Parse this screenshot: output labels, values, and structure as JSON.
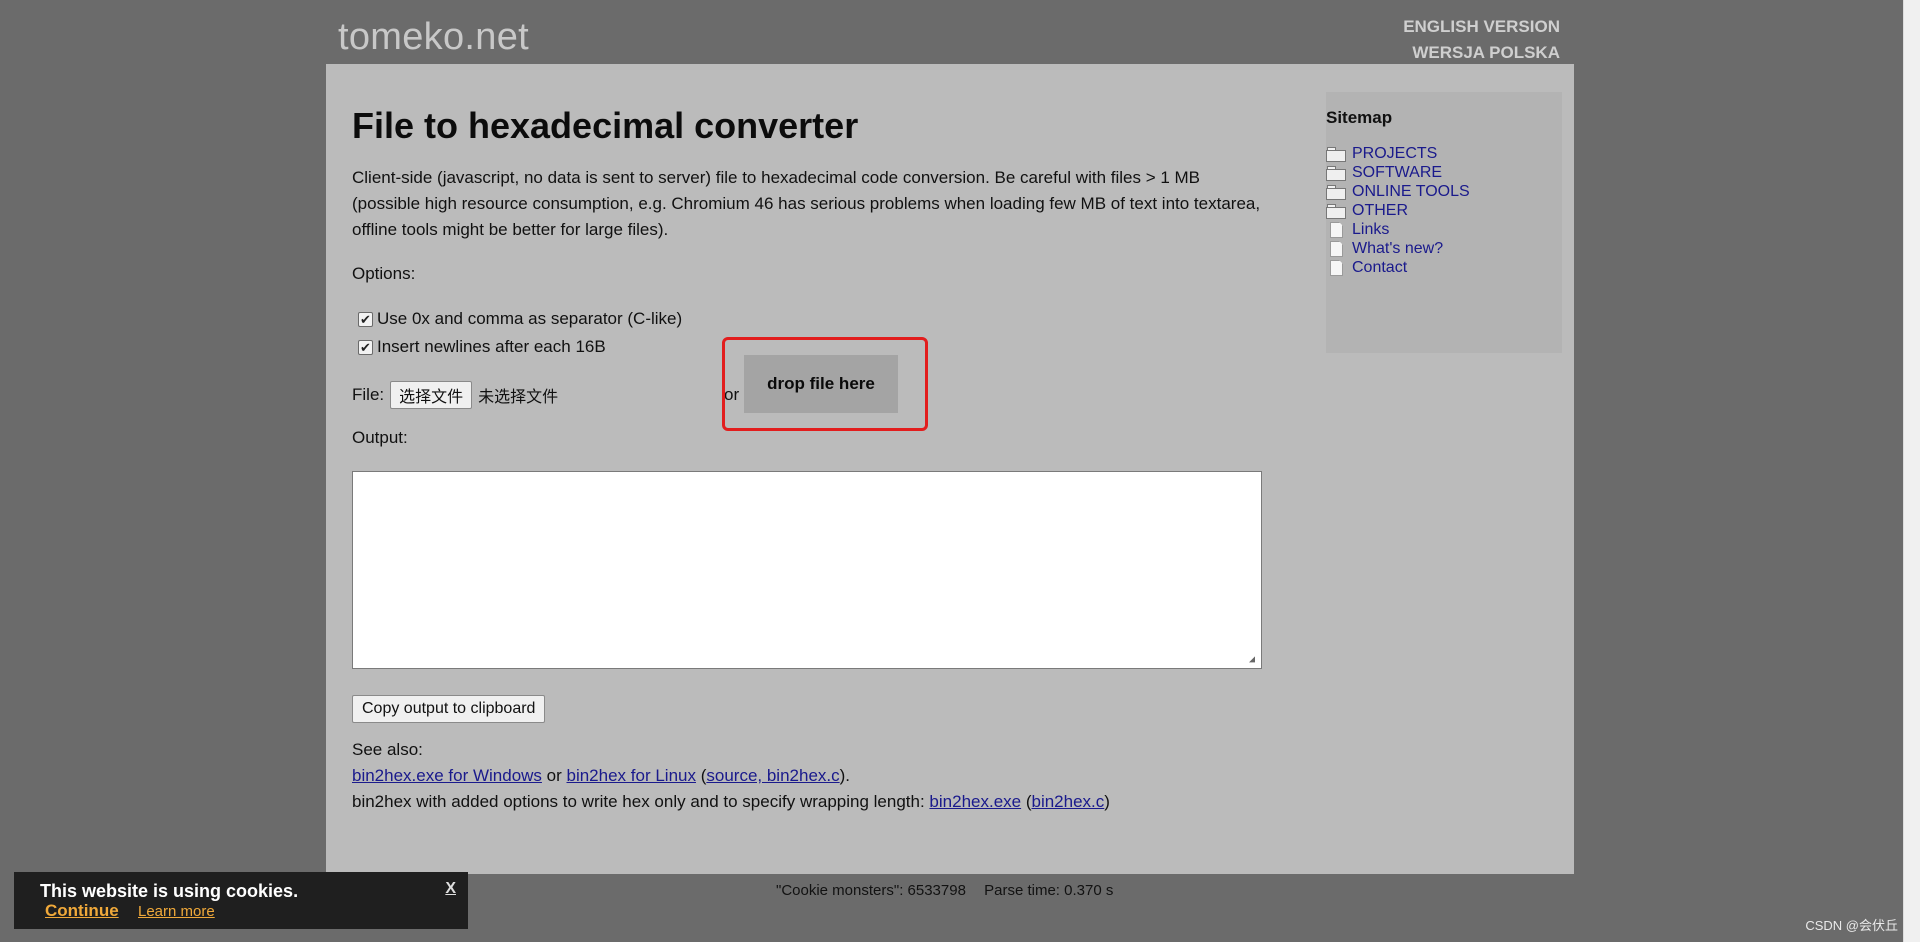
{
  "header": {
    "site_title": "tomeko.net",
    "lang_english": "ENGLISH VERSION",
    "lang_polish": "WERSJA POLSKA"
  },
  "main": {
    "title": "File to hexadecimal converter",
    "intro": "Client-side (javascript, no data is sent to server) file to hexadecimal code conversion. Be careful with files > 1 MB (possible high resource consumption, e.g. Chromium 46 has serious problems when loading few MB of text into textarea, offline tools might be better for large files).",
    "options_label": "Options:",
    "options": [
      {
        "label": "Use 0x and comma as separator (C-like)",
        "checked": true
      },
      {
        "label": "Insert newlines after each 16B",
        "checked": true
      }
    ],
    "file_label": "File:",
    "choose_button": "选择文件",
    "no_file_text": "未选择文件",
    "or_text": "or",
    "drop_zone_text": "drop file here",
    "output_label": "Output:",
    "output_value": "",
    "copy_button": "Copy output to clipboard",
    "see_also": {
      "heading": "See also:",
      "line1": {
        "link1": "bin2hex.exe for Windows",
        "sep1": " or ",
        "link2": "bin2hex for Linux",
        "paren_open": " (",
        "link3": "source, bin2hex.c",
        "paren_close": ")."
      },
      "line2": {
        "text": "bin2hex with added options to write hex only and to specify wrapping length: ",
        "link1": "bin2hex.exe",
        "paren_open": " (",
        "link2": "bin2hex.c",
        "paren_close": ")"
      }
    }
  },
  "sidebar": {
    "title": "Sitemap",
    "items": [
      {
        "label": "PROJECTS",
        "icon": "folder-icon"
      },
      {
        "label": "SOFTWARE",
        "icon": "folder-icon"
      },
      {
        "label": "ONLINE TOOLS",
        "icon": "folder-icon"
      },
      {
        "label": "OTHER",
        "icon": "folder-icon"
      },
      {
        "label": "Links",
        "icon": "page-icon"
      },
      {
        "label": "What's new?",
        "icon": "page-icon"
      },
      {
        "label": "Contact",
        "icon": "page-icon"
      }
    ]
  },
  "footer": {
    "cookie_monsters": "\"Cookie monsters\": 6533798",
    "parse_time": "Parse time: 0.370 s"
  },
  "cookie_bar": {
    "message": "This website is using cookies.",
    "continue": "Continue",
    "learn_more": "Learn more",
    "close": "X"
  },
  "watermark": "CSDN @会伏丘",
  "colors": {
    "background": "#6b6b6b",
    "panel": "#bbbbbb",
    "link": "#1a1a8c",
    "highlight_box": "#e21d1d",
    "cookie_link": "#f0a93a"
  }
}
